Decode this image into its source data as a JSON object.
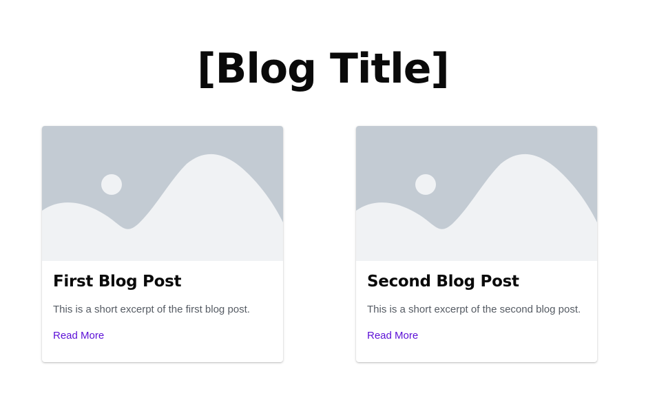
{
  "page": {
    "title": "[Blog Title]"
  },
  "posts": [
    {
      "title": "First Blog Post",
      "excerpt": "This is a short excerpt of the first blog post.",
      "link_label": "Read More",
      "image_icon": "image-placeholder-icon"
    },
    {
      "title": "Second Blog Post",
      "excerpt": "This is a short excerpt of the second blog post.",
      "link_label": "Read More",
      "image_icon": "image-placeholder-icon"
    }
  ],
  "colors": {
    "link": "#5b0fd6",
    "title": "#0a0a0a",
    "excerpt": "#555b63",
    "placeholder_bg": "#c3cbd3",
    "placeholder_fg": "#f0f2f4"
  }
}
